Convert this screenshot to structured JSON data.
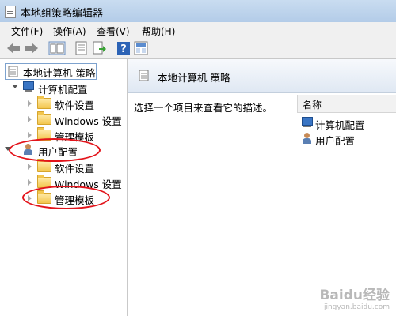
{
  "window": {
    "title": "本地组策略编辑器"
  },
  "menu": [
    "文件(F)",
    "操作(A)",
    "查看(V)",
    "帮助(H)"
  ],
  "tree": {
    "root": "本地计算机 策略",
    "computer": {
      "label": "计算机配置",
      "children": [
        "软件设置",
        "Windows 设置",
        "管理模板"
      ]
    },
    "user": {
      "label": "用户配置",
      "children": [
        "软件设置",
        "Windows 设置",
        "管理模板"
      ]
    }
  },
  "right": {
    "header": "本地计算机 策略",
    "description": "选择一个项目来查看它的描述。",
    "column": "名称",
    "items": [
      "计算机配置",
      "用户配置"
    ]
  },
  "watermark": {
    "line1": "Baidu经验",
    "line2": "jingyan.baidu.com"
  },
  "colors": {
    "annotation": "#e3141b",
    "selection_border": "#7da2ce"
  }
}
